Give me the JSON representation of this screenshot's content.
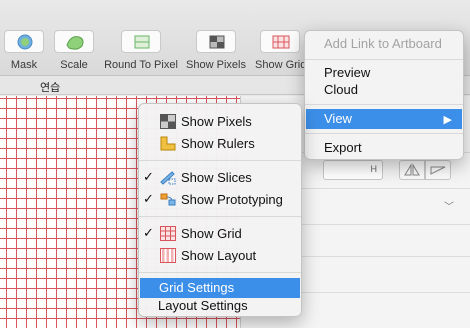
{
  "toolbar": {
    "items": [
      {
        "label": "Mask"
      },
      {
        "label": "Scale"
      },
      {
        "label": "Round To Pixel"
      },
      {
        "label": "Show Pixels"
      },
      {
        "label": "Show Grid"
      }
    ]
  },
  "tabbar": {
    "label": "연습"
  },
  "inspector": {
    "h_label": "H"
  },
  "context_menu": {
    "items": [
      {
        "label": "Add Link to Artboard",
        "enabled": false
      },
      {
        "label": "Preview"
      },
      {
        "label": "Cloud"
      },
      {
        "label": "View",
        "highlighted": true,
        "submenu_arrow": "▶"
      },
      {
        "label": "Export"
      }
    ]
  },
  "view_submenu": {
    "items": [
      {
        "label": "Show Pixels",
        "checked": false,
        "icon": "pixel-grid-icon"
      },
      {
        "label": "Show Rulers",
        "checked": false,
        "icon": "ruler-icon"
      },
      {
        "label": "Show Slices",
        "checked": true,
        "icon": "slice-icon",
        "check_mark": "✓"
      },
      {
        "label": "Show Prototyping",
        "checked": true,
        "icon": "prototyping-icon",
        "check_mark": "✓"
      },
      {
        "label": "Show Grid",
        "checked": true,
        "icon": "grid-icon",
        "check_mark": "✓"
      },
      {
        "label": "Show Layout",
        "checked": false,
        "icon": "layout-columns-icon"
      },
      {
        "label": "Grid Settings",
        "highlighted": true
      },
      {
        "label": "Layout Settings"
      }
    ]
  },
  "colors": {
    "highlight": "#3c8fe8",
    "grid_line": "#d9555c"
  }
}
